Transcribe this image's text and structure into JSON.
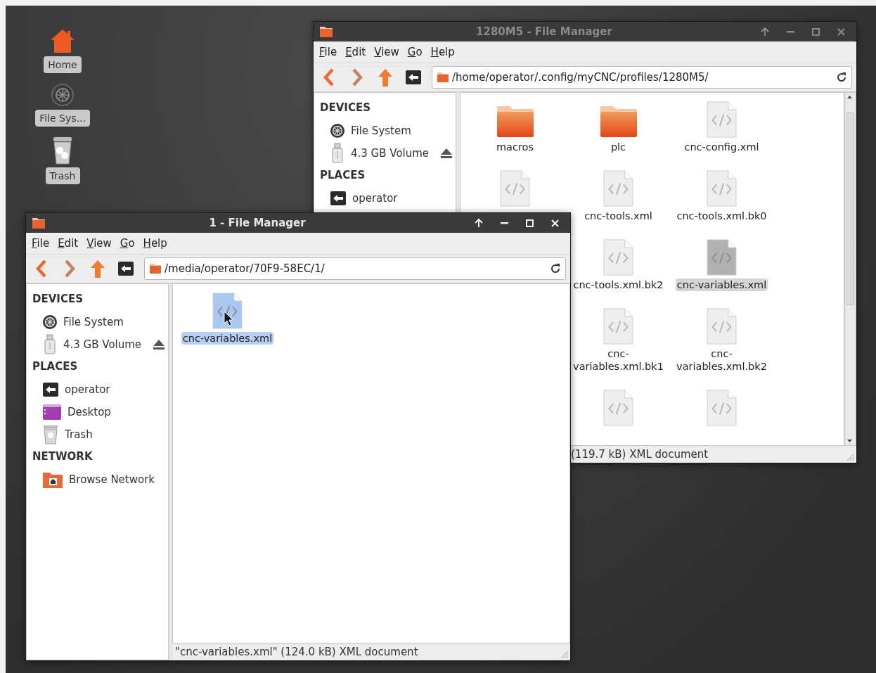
{
  "desktop": {
    "icons": [
      {
        "label": "Home",
        "kind": "home"
      },
      {
        "label": "File Sys...",
        "kind": "drive"
      },
      {
        "label": "Trash",
        "kind": "trash"
      }
    ]
  },
  "windows": [
    {
      "title": "1280M5 - File Manager",
      "active": false,
      "menu": [
        "File",
        "Edit",
        "View",
        "Go",
        "Help"
      ],
      "address": "/home/operator/.config/myCNC/profiles/1280M5/",
      "sidebar": [
        {
          "heading": "DEVICES",
          "items": [
            {
              "label": "File System",
              "kind": "drive",
              "eject": false
            },
            {
              "label": "4.3 GB Volume",
              "kind": "usb",
              "eject": true
            }
          ]
        },
        {
          "heading": "PLACES",
          "items": [
            {
              "label": "operator",
              "kind": "home",
              "eject": false
            }
          ]
        }
      ],
      "rows": [
        [
          {
            "name": "macros",
            "kind": "folder",
            "selected": false
          },
          {
            "name": "plc",
            "kind": "folder",
            "selected": false
          },
          {
            "name": "cnc-config.xml",
            "kind": "xml",
            "selected": false
          }
        ],
        [
          {
            "kind": "xml",
            "selected": false
          },
          {
            "name": "cnc-tools.xml",
            "kind": "xml",
            "selected": false
          },
          {
            "name": "cnc-tools.xml.bk0",
            "kind": "xml",
            "selected": false
          }
        ],
        [
          null,
          {
            "name": "cnc-tools.xml.bk2",
            "kind": "xml",
            "selected": false
          },
          {
            "name": "cnc-variables.xml",
            "kind": "xml",
            "selected": true
          }
        ],
        [
          null,
          {
            "name": "cnc-\nvariables.xml.bk1",
            "kind": "xml",
            "selected": false
          },
          {
            "name": "cnc-\nvariables.xml.bk2",
            "kind": "xml",
            "selected": false
          }
        ],
        [
          null,
          {
            "kind": "xml",
            "selected": false
          },
          {
            "kind": "xml",
            "selected": false
          }
        ]
      ],
      "status": "(119.7 kB) XML document"
    },
    {
      "title": "1 - File Manager",
      "active": true,
      "menu": [
        "File",
        "Edit",
        "View",
        "Go",
        "Help"
      ],
      "address": "/media/operator/70F9-58EC/1/",
      "sidebar": [
        {
          "heading": "DEVICES",
          "items": [
            {
              "label": "File System",
              "kind": "drive",
              "eject": false
            },
            {
              "label": "4.3 GB Volume",
              "kind": "usb",
              "eject": true
            }
          ]
        },
        {
          "heading": "PLACES",
          "items": [
            {
              "label": "operator",
              "kind": "home",
              "eject": false
            },
            {
              "label": "Desktop",
              "kind": "desktop",
              "eject": false
            },
            {
              "label": "Trash",
              "kind": "trash",
              "eject": false
            }
          ]
        },
        {
          "heading": "NETWORK",
          "items": [
            {
              "label": "Browse Network",
              "kind": "network",
              "eject": false
            }
          ]
        }
      ],
      "rows": [
        [
          {
            "name": "cnc-variables.xml",
            "kind": "xml",
            "selected": true
          }
        ]
      ],
      "status": "\"cnc-variables.xml\" (124.0 kB) XML document"
    }
  ]
}
